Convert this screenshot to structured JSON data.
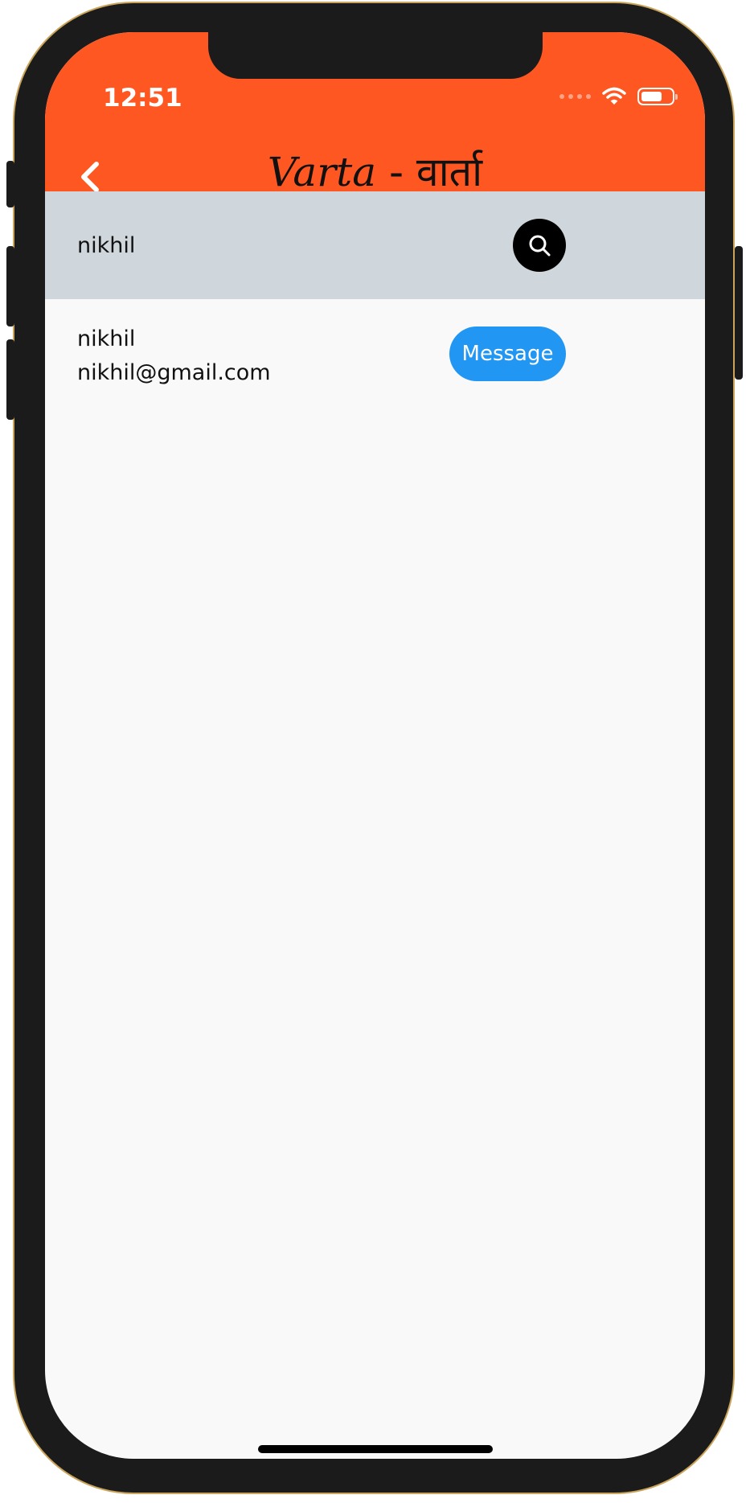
{
  "status_bar": {
    "time": "12:51",
    "battery_level": 0.7
  },
  "app_bar": {
    "title_latin": "Varta",
    "title_separator": " - ",
    "title_devanagari": "वार्ता",
    "color": "#ff5722"
  },
  "search": {
    "value": "nikhil",
    "placeholder": ""
  },
  "results": [
    {
      "name": "nikhil",
      "email": "nikhil@gmail.com",
      "action_label": "Message"
    }
  ],
  "colors": {
    "accent": "#2196f3",
    "search_bar_bg": "#d0d7dc",
    "screen_bg": "#f9f9f9"
  },
  "icons": {
    "back": "chevron-left-icon",
    "search": "search-icon",
    "wifi": "wifi-icon",
    "battery": "battery-icon"
  }
}
